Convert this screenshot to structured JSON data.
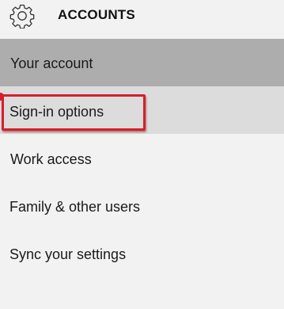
{
  "header": {
    "icon": "gear-icon",
    "title": "ACCOUNTS"
  },
  "nav": {
    "items": [
      {
        "label": "Your account",
        "state": "selected"
      },
      {
        "label": "Sign-in options",
        "state": "hover",
        "annotated": true
      },
      {
        "label": "Work access"
      },
      {
        "label": "Family & other users"
      },
      {
        "label": "Sync your settings"
      }
    ]
  },
  "colors": {
    "background": "#f2f2f2",
    "selected": "#adadad",
    "hover": "#dcdcdc",
    "annotation": "#d61f2a"
  }
}
